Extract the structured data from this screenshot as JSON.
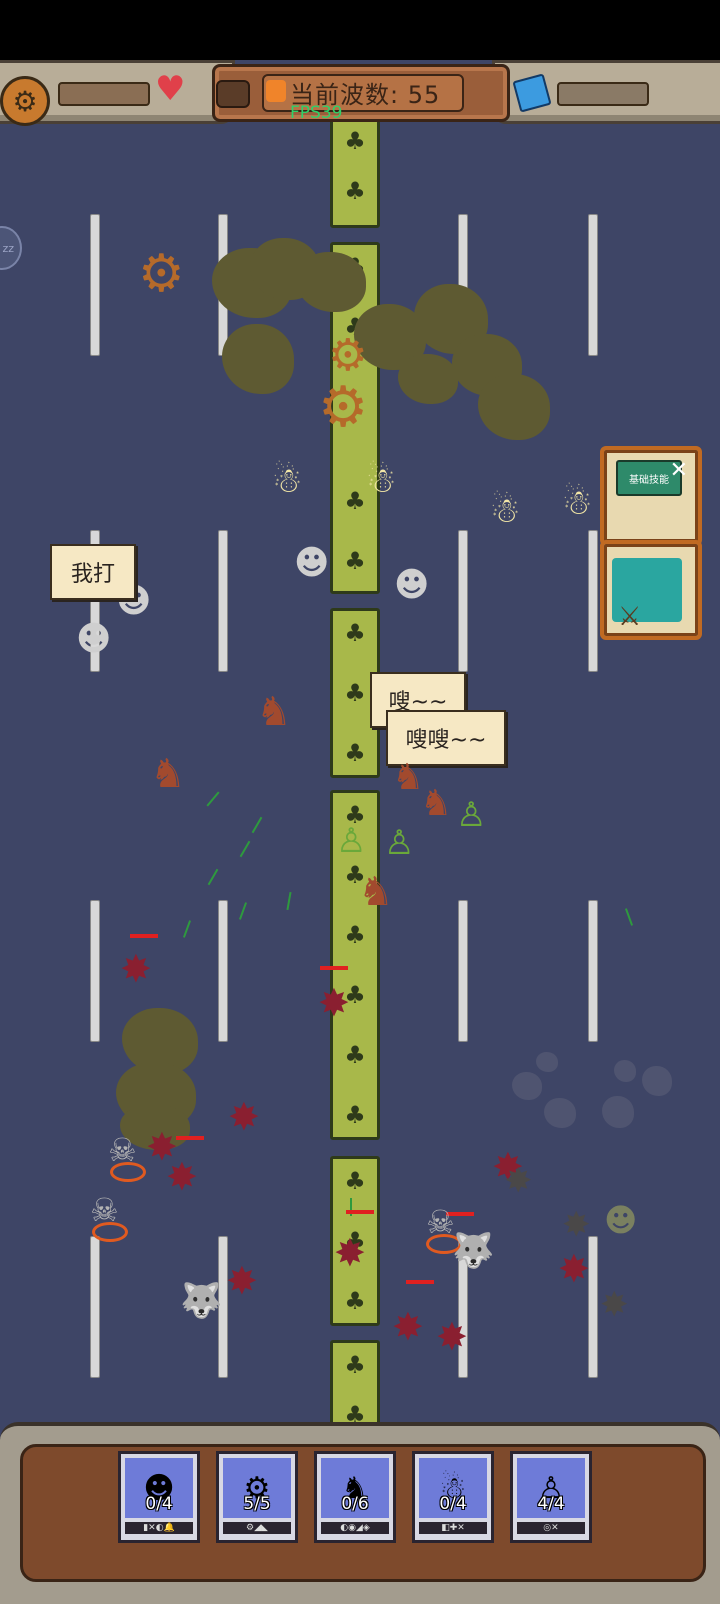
{
  "hud": {
    "wave_text": "当前波数: 55",
    "fps_text": "FPS39",
    "zz_label": "zz"
  },
  "bubbles": {
    "left": "我打",
    "center_back": "嗖~~",
    "center_front": "嗖嗖~~"
  },
  "cards": {
    "skill_card_label": "基础技能"
  },
  "unit_slots": [
    {
      "count": "0/4",
      "icon": "gunman-icon",
      "tags": "▮✕◐🔔"
    },
    {
      "count": "5/5",
      "icon": "catapult-icon",
      "tags": "⚙◢◣"
    },
    {
      "count": "0/6",
      "icon": "horse-rider-icon",
      "tags": "◐◉◢◈"
    },
    {
      "count": "0/4",
      "icon": "ghost-icon",
      "tags": "◧✚✕"
    },
    {
      "count": "4/4",
      "icon": "elf-archer-icon",
      "tags": "◎✕"
    }
  ],
  "colors": {
    "field": "#3e4566",
    "median": "#a8b84a",
    "hud_panel": "#b8ad98",
    "wave_panel": "#9a5e3a",
    "fps": "#2fd06a",
    "slot_portrait": "#6e7bd8"
  }
}
